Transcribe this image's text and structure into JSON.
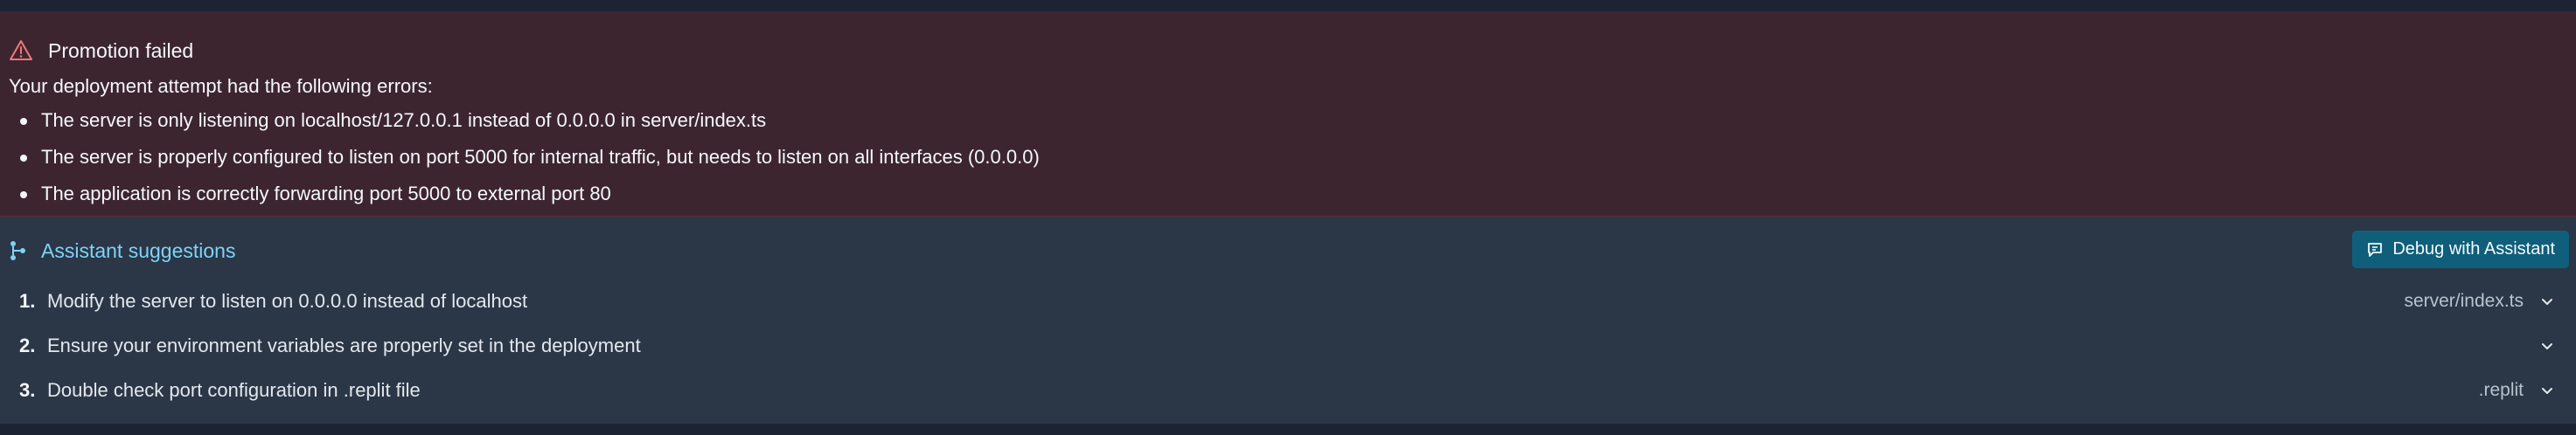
{
  "error": {
    "title": "Promotion failed",
    "intro": "Your deployment attempt had the following errors:",
    "items": [
      "The server is only listening on localhost/127.0.0.1 instead of 0.0.0.0 in server/index.ts",
      "The server is properly configured to listen on port 5000 for internal traffic, but needs to listen on all interfaces (0.0.0.0)",
      "The application is correctly forwarding port 5000 to external port 80"
    ]
  },
  "assistant": {
    "title": "Assistant suggestions",
    "debug_label": "Debug with Assistant",
    "suggestions": [
      {
        "num": "1.",
        "text": "Modify the server to listen on 0.0.0.0 instead of localhost",
        "file": "server/index.ts"
      },
      {
        "num": "2.",
        "text": "Ensure your environment variables are properly set in the deployment",
        "file": ""
      },
      {
        "num": "3.",
        "text": "Double check port configuration in .replit file",
        "file": ".replit"
      }
    ]
  },
  "colors": {
    "error_bg": "#3d252f",
    "assistant_bg": "#2b3647",
    "accent": "#7dd4f5",
    "button_bg": "#0f5f7a",
    "warning": "#f2777a"
  },
  "icons": {
    "warning": "warning-triangle-icon",
    "assistant": "assistant-icon",
    "debug": "chat-bubble-icon",
    "expand": "chevron-down-icon"
  }
}
